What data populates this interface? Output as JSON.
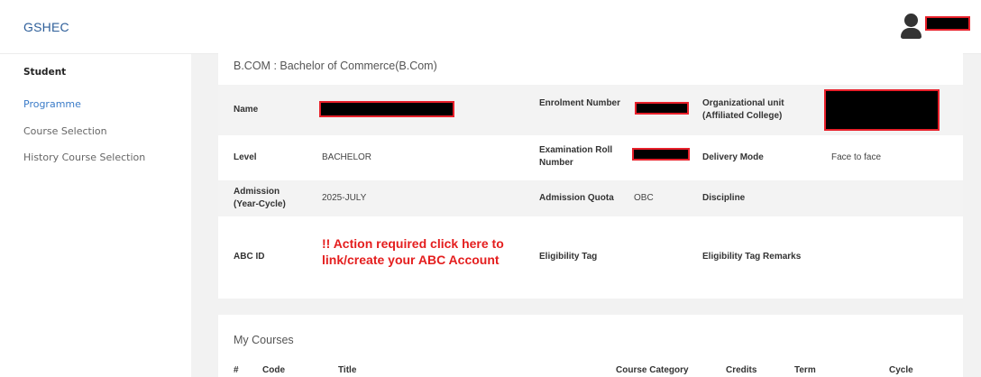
{
  "app": {
    "title": "GSHEC"
  },
  "colors": {
    "brand": "#2e5f9a",
    "active_nav": "#3a7bc8",
    "warning": "#e41e1e",
    "redaction_border": "#e8202a"
  },
  "header": {
    "user_icon": "user-icon"
  },
  "sidebar": {
    "title": "Student",
    "items": [
      {
        "label": "Programme",
        "active": true
      },
      {
        "label": "Course Selection",
        "active": false
      },
      {
        "label": "History Course Selection",
        "active": false
      }
    ]
  },
  "programme": {
    "title": "B.COM : Bachelor of Commerce(B.Com)",
    "rows": [
      {
        "c1_label": "Name",
        "c1_value": "",
        "c2_label": "Enrolment Number",
        "c2_value": "",
        "c3_label": "Organizational unit (Affiliated College)",
        "c3_value": ""
      },
      {
        "c1_label": "Level",
        "c1_value": "BACHELOR",
        "c2_label": "Examination Roll Number",
        "c2_value": "",
        "c3_label": "Delivery Mode",
        "c3_value": "Face to face"
      },
      {
        "c1_label": "Admission (Year-Cycle)",
        "c1_value": "2025-JULY",
        "c2_label": "Admission Quota",
        "c2_value": "OBC",
        "c3_label": "Discipline",
        "c3_value": ""
      },
      {
        "c1_label": "ABC ID",
        "c1_value": "!! Action required click here to link/create your ABC Account",
        "c2_label": "Eligibility Tag",
        "c2_value": "",
        "c3_label": "Eligibility Tag Remarks",
        "c3_value": ""
      }
    ]
  },
  "courses": {
    "title": "My Courses",
    "columns": [
      "#",
      "Code",
      "Title",
      "Course Category",
      "Credits",
      "Term",
      "Cycle"
    ]
  }
}
